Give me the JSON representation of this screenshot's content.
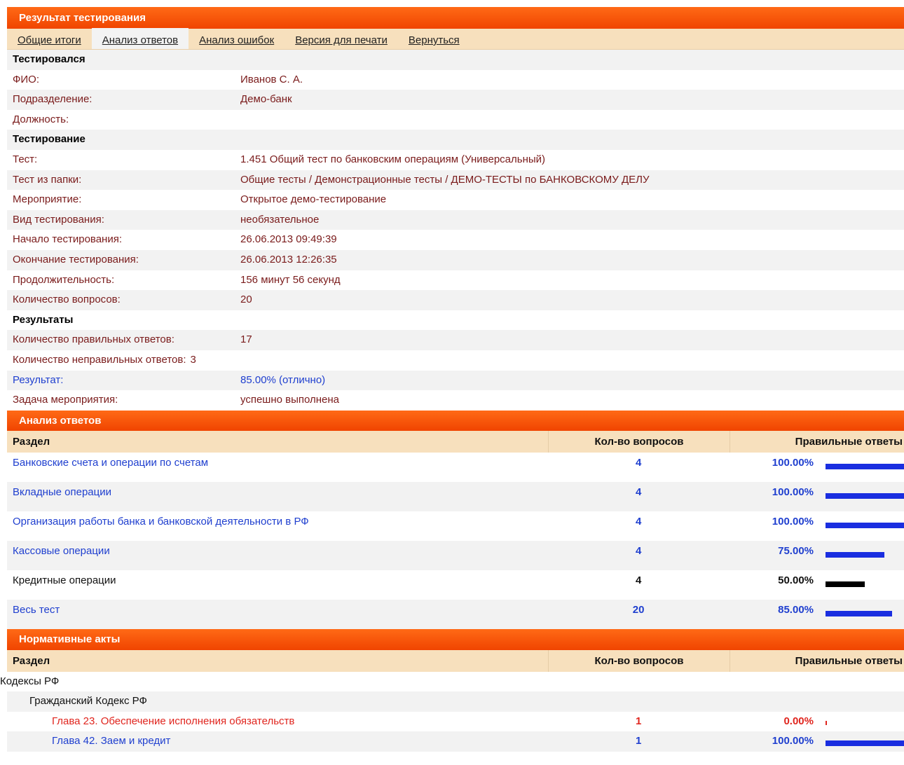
{
  "header": {
    "title": "Результат тестирования"
  },
  "tabs": [
    {
      "label": "Общие итоги"
    },
    {
      "label": "Анализ ответов"
    },
    {
      "label": "Анализ ошибок"
    },
    {
      "label": "Версия для печати"
    },
    {
      "label": "Вернуться"
    }
  ],
  "info": {
    "group_tested": "Тестировался",
    "fio_label": "ФИО:",
    "fio_value": "Иванов С. А.",
    "dept_label": "Подразделение:",
    "dept_value": "Демо-банк",
    "position_label": "Должность:",
    "position_value": "",
    "group_testing": "Тестирование",
    "test_label": "Тест:",
    "test_value": "1.451 Общий тест по банковским операциям (Универсальный)",
    "folder_label": "Тест из папки:",
    "folder_value": "Общие тесты / Демонстрационные тесты / ДЕМО-ТЕСТЫ по БАНКОВСКОМУ ДЕЛУ",
    "event_label": "Мероприятие:",
    "event_value": "Открытое демо-тестирование",
    "kind_label": "Вид тестирования:",
    "kind_value": "необязательное",
    "start_label": "Начало тестирования:",
    "start_value": "26.06.2013 09:49:39",
    "end_label": "Окончание тестирования:",
    "end_value": "26.06.2013 12:26:35",
    "duration_label": "Продолжительность:",
    "duration_value": "156 минут 56 секунд",
    "questions_label": "Количество вопросов:",
    "questions_value": "20",
    "group_results": "Результаты",
    "correct_label": "Количество правильных ответов:",
    "correct_value": "17",
    "wrong_label": "Количество неправильных ответов:",
    "wrong_value": "3",
    "result_label": "Результат:",
    "result_value": "85.00% (отлично)",
    "task_label": "Задача мероприятия:",
    "task_value": "успешно выполнена"
  },
  "analysis": {
    "title": "Анализ ответов",
    "columns": {
      "section": "Раздел",
      "count": "Кол-во вопросов",
      "correct": "Правильные ответы"
    },
    "rows": [
      {
        "section": "Банковские счета и операции по счетам",
        "count": "4",
        "percent": "100.00%",
        "fill": 1.0,
        "color": "#1a2ee0"
      },
      {
        "section": "Вкладные операции",
        "count": "4",
        "percent": "100.00%",
        "fill": 1.0,
        "color": "#1a2ee0"
      },
      {
        "section": "Организация работы банка и банковской деятельности в РФ",
        "count": "4",
        "percent": "100.00%",
        "fill": 1.0,
        "color": "#1a2ee0"
      },
      {
        "section": "Кассовые операции",
        "count": "4",
        "percent": "75.00%",
        "fill": 0.75,
        "color": "#1a2ee0"
      },
      {
        "section": "Кредитные операции",
        "count": "4",
        "percent": "50.00%",
        "fill": 0.5,
        "color": "#000000"
      },
      {
        "section": "Весь тест",
        "count": "20",
        "percent": "85.00%",
        "fill": 0.85,
        "color": "#1a2ee0"
      }
    ]
  },
  "normative": {
    "title": "Нормативные акты",
    "columns": {
      "section": "Раздел",
      "count": "Кол-во вопросов",
      "correct": "Правильные ответы"
    },
    "rows": [
      {
        "section": "Кодексы РФ",
        "count": "",
        "percent": "",
        "fill": null,
        "level": 0,
        "color": ""
      },
      {
        "section": "Гражданский Кодекс РФ",
        "count": "",
        "percent": "",
        "fill": null,
        "level": 1,
        "color": ""
      },
      {
        "section": "Глава 23. Обеспечение исполнения обязательств",
        "count": "1",
        "percent": "0.00%",
        "fill": 0.0,
        "level": 2,
        "color": "#e0251e"
      },
      {
        "section": "Глава 42. Заем и кредит",
        "count": "1",
        "percent": "100.00%",
        "fill": 1.0,
        "level": 2,
        "color": "#1a2ee0"
      }
    ]
  }
}
